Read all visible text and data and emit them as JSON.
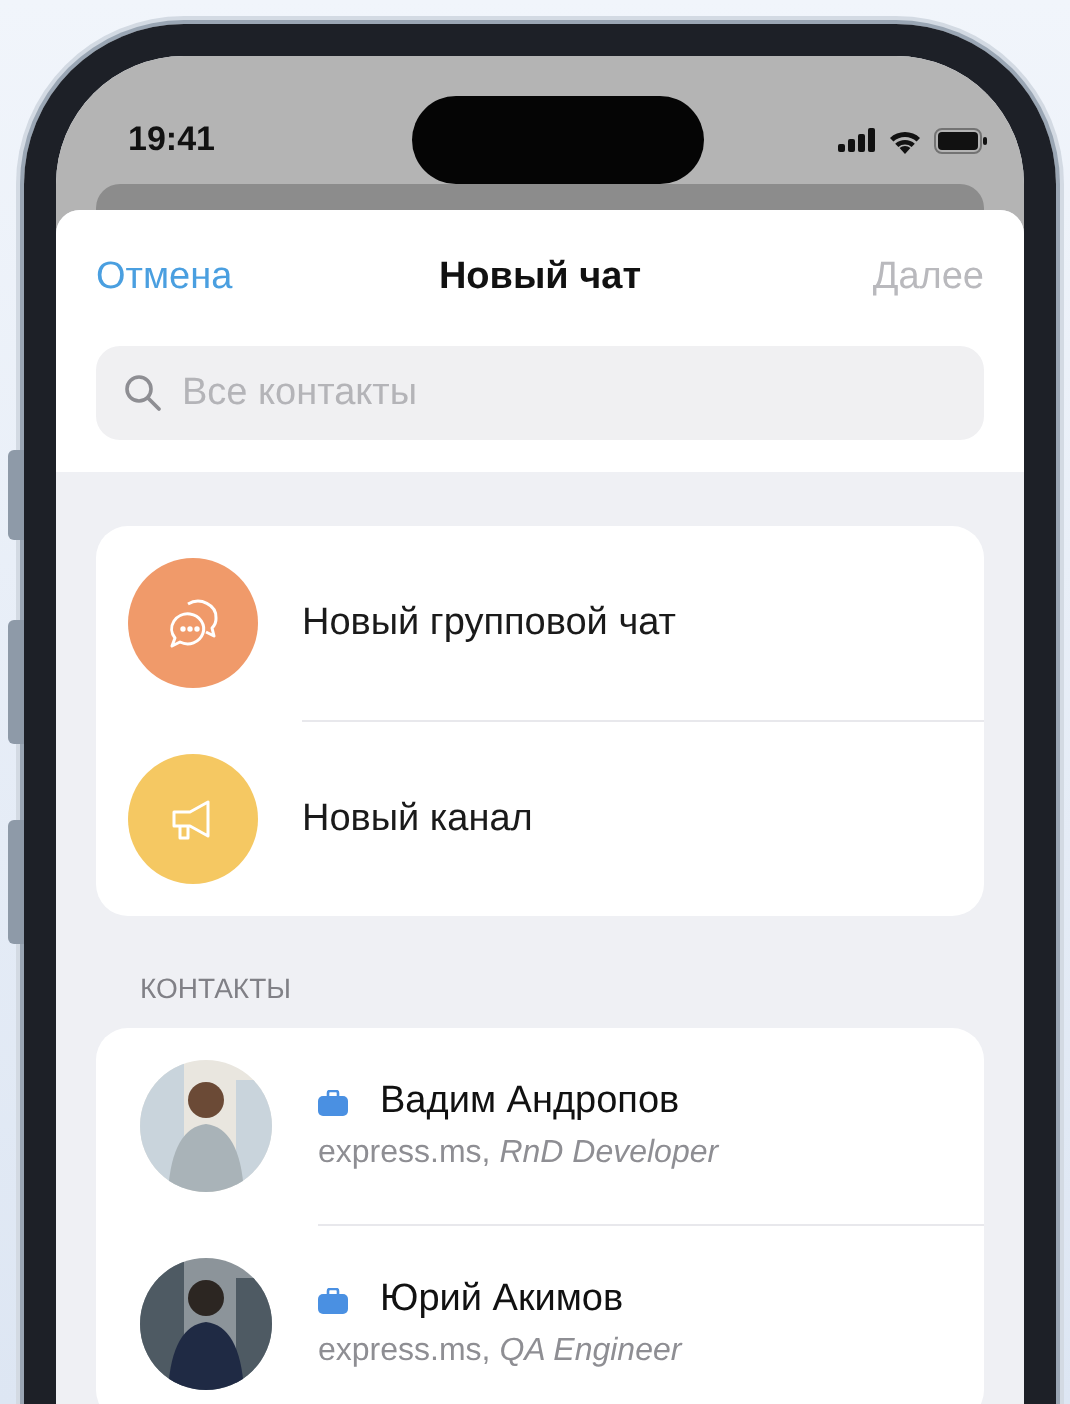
{
  "status_bar": {
    "time": "19:41"
  },
  "header": {
    "cancel": "Отмена",
    "title": "Новый чат",
    "next": {
      "label": "Далее",
      "disabled": true
    }
  },
  "search": {
    "placeholder": "Все контакты"
  },
  "actions": [
    {
      "kind": "group",
      "label": "Новый групповой чат",
      "color": "#f09a6a"
    },
    {
      "kind": "channel",
      "label": "Новый канал",
      "color": "#f5c862"
    }
  ],
  "contacts_header": "КОНТАКТЫ",
  "contacts": [
    {
      "name": "Вадим Андропов",
      "subtitle": "express.ms, *RnD Developer*",
      "work": true,
      "kind": "light"
    },
    {
      "name": "Юрий Акимов",
      "subtitle": "express.ms, *QA Engineer*",
      "work": true,
      "kind": "dark"
    }
  ]
}
